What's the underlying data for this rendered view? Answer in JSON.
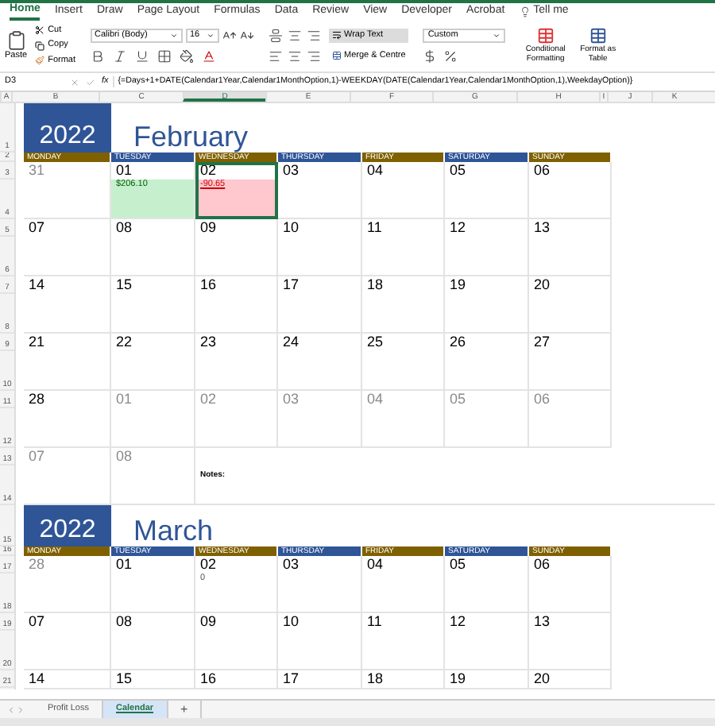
{
  "ribbon": {
    "tabs": [
      {
        "label": "Home",
        "selected": true
      },
      {
        "label": "Insert",
        "selected": false
      },
      {
        "label": "Draw",
        "selected": false
      },
      {
        "label": "Page Layout",
        "selected": false
      },
      {
        "label": "Formulas",
        "selected": false
      },
      {
        "label": "Data",
        "selected": false
      },
      {
        "label": "Review",
        "selected": false
      },
      {
        "label": "View",
        "selected": false
      },
      {
        "label": "Developer",
        "selected": false
      },
      {
        "label": "Acrobat",
        "selected": false
      },
      {
        "label": "Tell me",
        "selected": false,
        "kind": "search"
      }
    ],
    "paste": "Paste",
    "cut": "Cut",
    "copy": "Copy",
    "format": "Format",
    "font": "Calibri (Body)",
    "size": "16",
    "wrap_text": "Wrap Text",
    "merge": "Merge & Centre",
    "number_format": "Custom",
    "styles": [
      "Conditional Formatting",
      "Format as Table"
    ]
  },
  "formula_bar": {
    "name_box": "D3",
    "fx": "fx",
    "formula": "{=Days+1+DATE(Calendar1Year,Calendar1MonthOption,1)-WEEKDAY(DATE(Calendar1Year,Calendar1MonthOption,1),WeekdayOption)}"
  },
  "columns": [
    {
      "label": "A",
      "selected": false
    },
    {
      "label": "B",
      "selected": false
    },
    {
      "label": "C",
      "selected": false
    },
    {
      "label": "D",
      "selected": true
    },
    {
      "label": "E",
      "selected": false
    },
    {
      "label": "F",
      "selected": false
    },
    {
      "label": "G",
      "selected": false
    },
    {
      "label": "H",
      "selected": false
    },
    {
      "label": "I",
      "selected": false
    },
    {
      "label": "J",
      "selected": false
    },
    {
      "label": "K",
      "selected": false
    }
  ],
  "calendars": [
    {
      "year": "2022",
      "month": "February",
      "rows": [
        "1",
        "2"
      ],
      "headers": [
        {
          "label": "MONDAY",
          "color": "#7f6000"
        },
        {
          "label": "TUESDAY",
          "color": "#2f5597"
        },
        {
          "label": "WEDNESDAY",
          "color": "#7f6000"
        },
        {
          "label": "THURSDAY",
          "color": "#2f5597"
        },
        {
          "label": "FRIDAY",
          "color": "#7f6000"
        },
        {
          "label": "SATURDAY",
          "color": "#2f5597"
        },
        {
          "label": "SUNDAY",
          "color": "#7f6000"
        }
      ],
      "weeks": [
        {
          "rows": [
            "3",
            "4"
          ],
          "days": [
            {
              "day": "31",
              "muted": true,
              "selected": false
            },
            {
              "day": "01",
              "muted": false,
              "selected": false,
              "note": {
                "text": "$206.10",
                "kind": "positive"
              }
            },
            {
              "day": "02",
              "muted": false,
              "selected": true,
              "note": {
                "text": "-90.65",
                "kind": "negative"
              }
            },
            {
              "day": "03",
              "muted": false,
              "selected": false
            },
            {
              "day": "04",
              "muted": false,
              "selected": false
            },
            {
              "day": "05",
              "muted": false,
              "selected": false
            },
            {
              "day": "06",
              "muted": false,
              "selected": false
            }
          ]
        },
        {
          "rows": [
            "5",
            "6"
          ],
          "days": [
            {
              "day": "07",
              "muted": false,
              "selected": false
            },
            {
              "day": "08",
              "muted": false,
              "selected": false
            },
            {
              "day": "09",
              "muted": false,
              "selected": false
            },
            {
              "day": "10",
              "muted": false,
              "selected": false
            },
            {
              "day": "11",
              "muted": false,
              "selected": false
            },
            {
              "day": "12",
              "muted": false,
              "selected": false
            },
            {
              "day": "13",
              "muted": false,
              "selected": false
            }
          ]
        },
        {
          "rows": [
            "7",
            "8"
          ],
          "days": [
            {
              "day": "14",
              "muted": false,
              "selected": false
            },
            {
              "day": "15",
              "muted": false,
              "selected": false
            },
            {
              "day": "16",
              "muted": false,
              "selected": false
            },
            {
              "day": "17",
              "muted": false,
              "selected": false
            },
            {
              "day": "18",
              "muted": false,
              "selected": false
            },
            {
              "day": "19",
              "muted": false,
              "selected": false
            },
            {
              "day": "20",
              "muted": false,
              "selected": false
            }
          ]
        },
        {
          "rows": [
            "9",
            "10"
          ],
          "days": [
            {
              "day": "21",
              "muted": false,
              "selected": false
            },
            {
              "day": "22",
              "muted": false,
              "selected": false
            },
            {
              "day": "23",
              "muted": false,
              "selected": false
            },
            {
              "day": "24",
              "muted": false,
              "selected": false
            },
            {
              "day": "25",
              "muted": false,
              "selected": false
            },
            {
              "day": "26",
              "muted": false,
              "selected": false
            },
            {
              "day": "27",
              "muted": false,
              "selected": false
            }
          ]
        },
        {
          "rows": [
            "11",
            "12"
          ],
          "days": [
            {
              "day": "28",
              "muted": false,
              "selected": false
            },
            {
              "day": "01",
              "muted": true,
              "selected": false
            },
            {
              "day": "02",
              "muted": true,
              "selected": false
            },
            {
              "day": "03",
              "muted": true,
              "selected": false
            },
            {
              "day": "04",
              "muted": true,
              "selected": false
            },
            {
              "day": "05",
              "muted": true,
              "selected": false
            },
            {
              "day": "06",
              "muted": true,
              "selected": false
            }
          ]
        },
        {
          "rows": [
            "13",
            "14"
          ],
          "days": [
            {
              "day": "07",
              "muted": true,
              "selected": false
            },
            {
              "day": "08",
              "muted": true,
              "selected": false
            }
          ],
          "notes_label": "Notes:"
        }
      ]
    },
    {
      "year": "2022",
      "month": "March",
      "rows": [
        "15",
        "16"
      ],
      "headers": [
        {
          "label": "MONDAY",
          "color": "#7f6000"
        },
        {
          "label": "TUESDAY",
          "color": "#2f5597"
        },
        {
          "label": "WEDNESDAY",
          "color": "#7f6000"
        },
        {
          "label": "THURSDAY",
          "color": "#2f5597"
        },
        {
          "label": "FRIDAY",
          "color": "#7f6000"
        },
        {
          "label": "SATURDAY",
          "color": "#2f5597"
        },
        {
          "label": "SUNDAY",
          "color": "#7f6000"
        }
      ],
      "weeks": [
        {
          "rows": [
            "17",
            "18"
          ],
          "days": [
            {
              "day": "28",
              "muted": true,
              "selected": false
            },
            {
              "day": "01",
              "muted": false,
              "selected": false
            },
            {
              "day": "02",
              "muted": false,
              "selected": false,
              "note": {
                "text": "0",
                "kind": "plain"
              }
            },
            {
              "day": "03",
              "muted": false,
              "selected": false
            },
            {
              "day": "04",
              "muted": false,
              "selected": false
            },
            {
              "day": "05",
              "muted": false,
              "selected": false
            },
            {
              "day": "06",
              "muted": false,
              "selected": false
            }
          ]
        },
        {
          "rows": [
            "19",
            "20"
          ],
          "days": [
            {
              "day": "07",
              "muted": false,
              "selected": false
            },
            {
              "day": "08",
              "muted": false,
              "selected": false
            },
            {
              "day": "09",
              "muted": false,
              "selected": false
            },
            {
              "day": "10",
              "muted": false,
              "selected": false
            },
            {
              "day": "11",
              "muted": false,
              "selected": false
            },
            {
              "day": "12",
              "muted": false,
              "selected": false
            },
            {
              "day": "13",
              "muted": false,
              "selected": false
            }
          ]
        },
        {
          "rows": [
            "21"
          ],
          "days": [
            {
              "day": "14",
              "muted": false,
              "selected": false
            },
            {
              "day": "15",
              "muted": false,
              "selected": false
            },
            {
              "day": "16",
              "muted": false,
              "selected": false
            },
            {
              "day": "17",
              "muted": false,
              "selected": false
            },
            {
              "day": "18",
              "muted": false,
              "selected": false
            },
            {
              "day": "19",
              "muted": false,
              "selected": false
            },
            {
              "day": "20",
              "muted": false,
              "selected": false
            }
          ]
        }
      ]
    }
  ],
  "sheet_tabs": [
    {
      "label": "Profit Loss",
      "selected": false
    },
    {
      "label": "Calendar",
      "selected": true
    },
    {
      "label": "+",
      "kind": "add",
      "selected": false
    }
  ]
}
